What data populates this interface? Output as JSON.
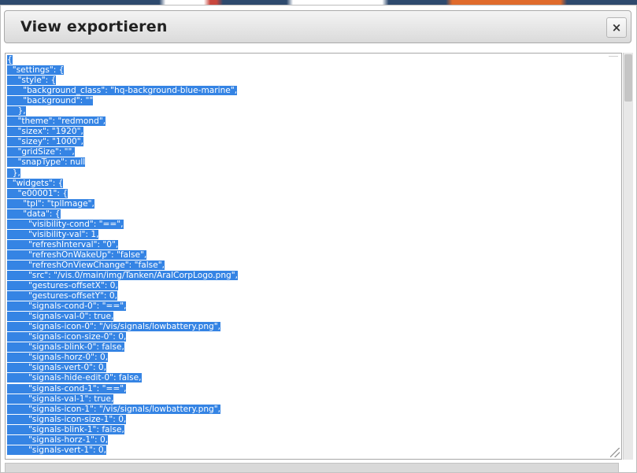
{
  "dialog": {
    "title": "View exportieren",
    "close_label": "×"
  },
  "icons": {
    "close": "close-icon",
    "resize": "resize-grip-icon"
  },
  "colors": {
    "selection": "#3584e4",
    "titlebar": "#e3e3e3"
  },
  "editor": {
    "lines": [
      "{",
      "  \"settings\": {",
      "    \"style\": {",
      "      \"background_class\": \"hq-background-blue-marine\",",
      "      \"background\": \"\"",
      "    },",
      "    \"theme\": \"redmond\",",
      "    \"sizex\": \"1920\",",
      "    \"sizey\": \"1000\",",
      "    \"gridSize\": \"\",",
      "    \"snapType\": null",
      "  },",
      "  \"widgets\": {",
      "    \"e00001\": {",
      "      \"tpl\": \"tplImage\",",
      "      \"data\": {",
      "        \"visibility-cond\": \"==\",",
      "        \"visibility-val\": 1,",
      "        \"refreshInterval\": \"0\",",
      "        \"refreshOnWakeUp\": \"false\",",
      "        \"refreshOnViewChange\": \"false\",",
      "        \"src\": \"/vis.0/main/img/Tanken/AralCorpLogo.png\",",
      "        \"gestures-offsetX\": 0,",
      "        \"gestures-offsetY\": 0,",
      "        \"signals-cond-0\": \"==\",",
      "        \"signals-val-0\": true,",
      "        \"signals-icon-0\": \"/vis/signals/lowbattery.png\",",
      "        \"signals-icon-size-0\": 0,",
      "        \"signals-blink-0\": false,",
      "        \"signals-horz-0\": 0,",
      "        \"signals-vert-0\": 0,",
      "        \"signals-hide-edit-0\": false,",
      "        \"signals-cond-1\": \"==\",",
      "        \"signals-val-1\": true,",
      "        \"signals-icon-1\": \"/vis/signals/lowbattery.png\",",
      "        \"signals-icon-size-1\": 0,",
      "        \"signals-blink-1\": false,",
      "        \"signals-horz-1\": 0,",
      "        \"signals-vert-1\": 0,"
    ]
  }
}
